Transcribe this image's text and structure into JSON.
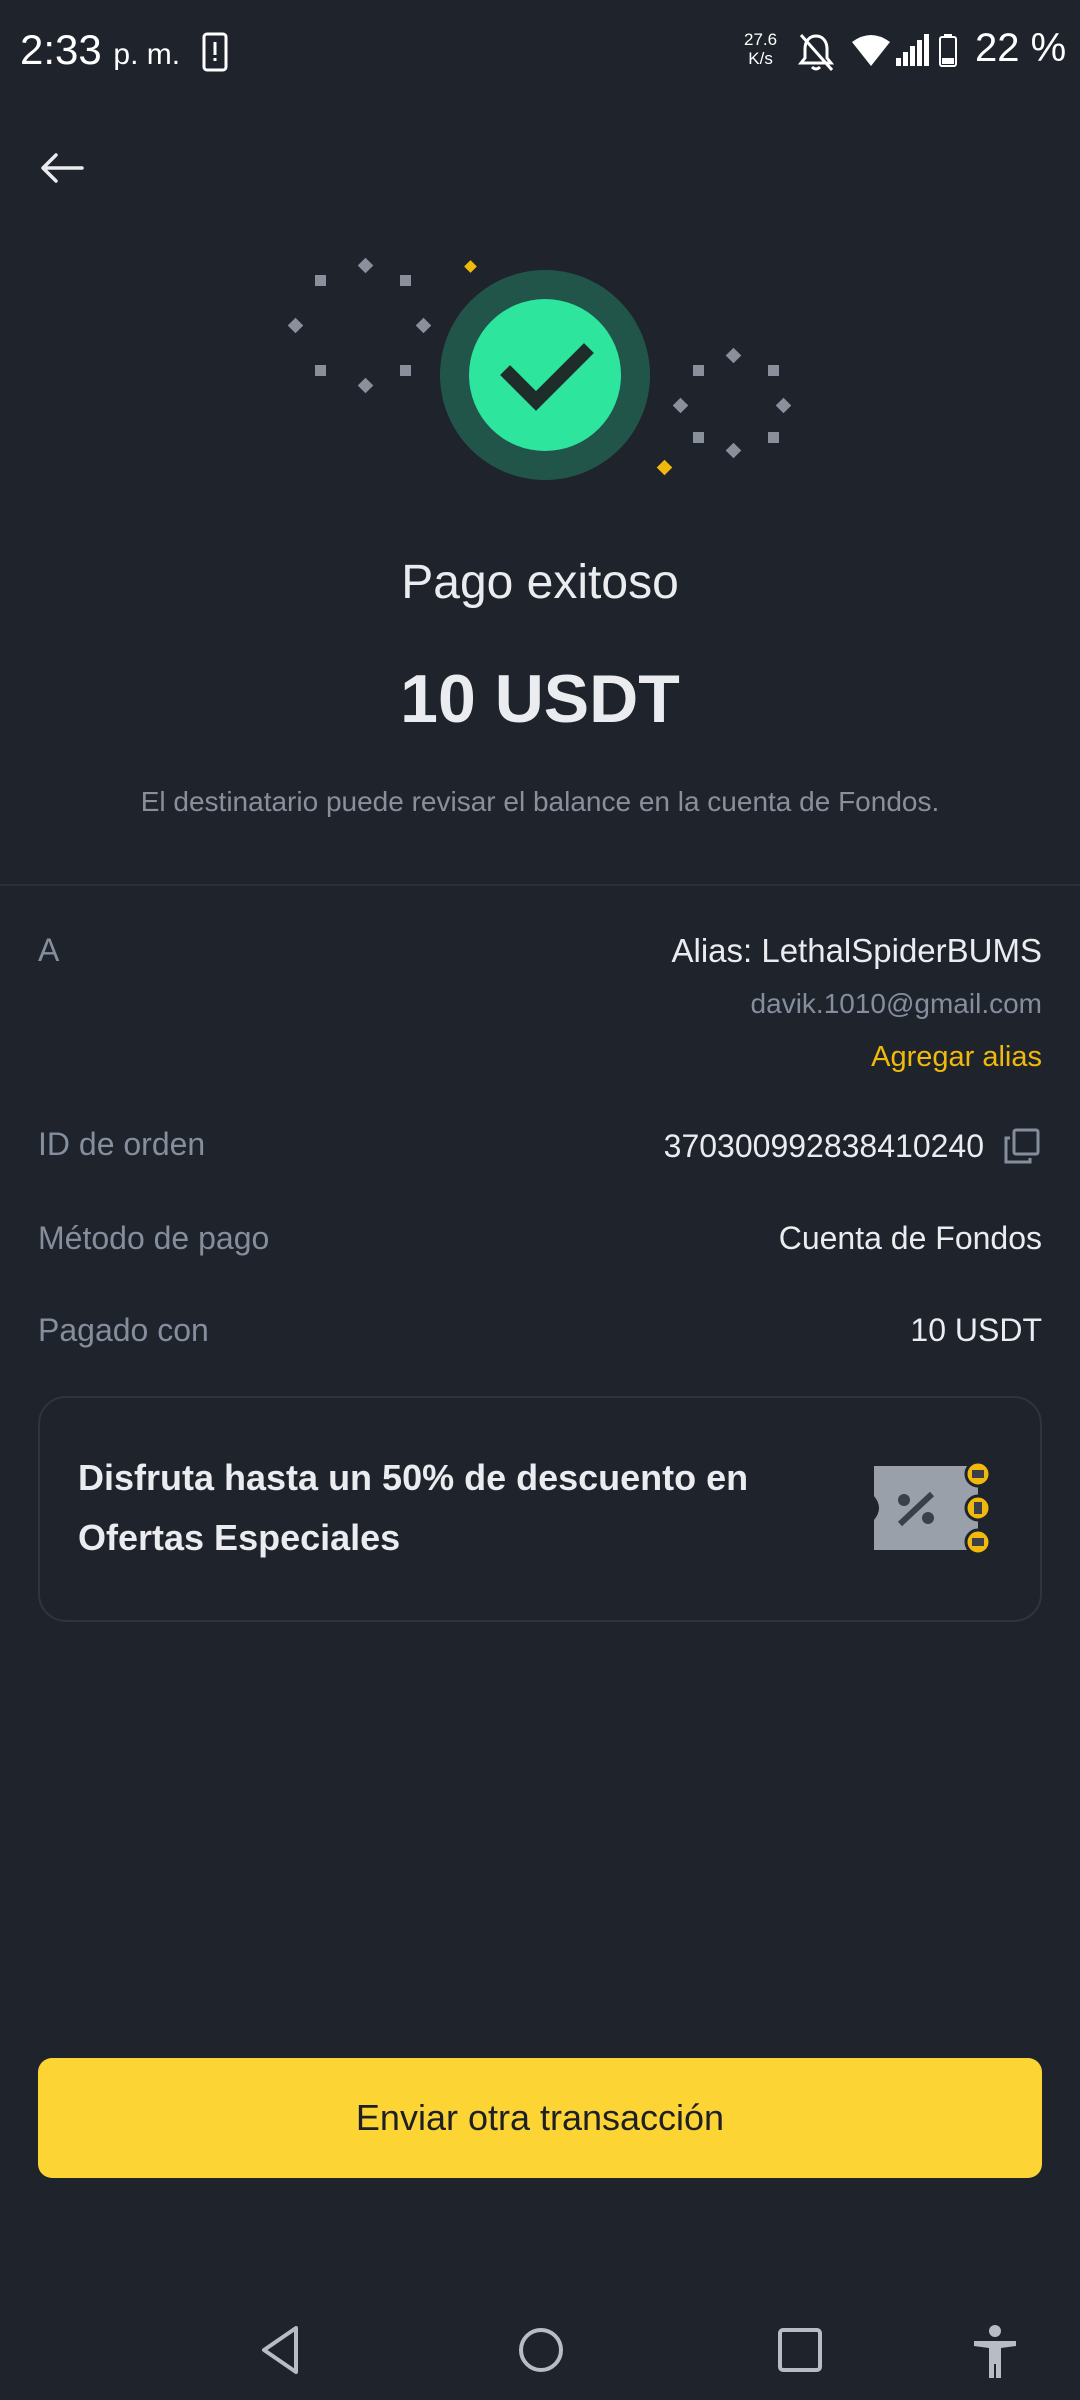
{
  "status_bar": {
    "time": "2:33",
    "ampm": "p. m.",
    "speed_value": "27.6",
    "speed_unit": "K/s",
    "battery": "22 %"
  },
  "icons": {
    "back": "arrow-left-icon",
    "success": "checkmark-icon",
    "copy": "copy-icon",
    "promo": "discount-ticket-icon"
  },
  "result": {
    "title": "Pago exitoso",
    "amount": "10 USDT",
    "subtitle": "El destinatario puede revisar el balance en la cuenta de Fondos."
  },
  "details": {
    "to_label": "A",
    "to_alias": "Alias: LethalSpiderBUMS",
    "to_email": "davik.1010@gmail.com",
    "add_alias": "Agregar alias",
    "order_label": "ID de orden",
    "order_value": "370300992838410240",
    "method_label": "Método de pago",
    "method_value": "Cuenta de Fondos",
    "paid_label": "Pagado con",
    "paid_value": "10 USDT"
  },
  "promo": {
    "text": "Disfruta hasta un 50% de descuento en Ofertas Especiales"
  },
  "actions": {
    "primary": "Enviar otra transacción"
  },
  "colors": {
    "background": "#1f232c",
    "accent_yellow": "#fcd535",
    "link_yellow": "#f0b90b",
    "success_green": "#2ee59d",
    "muted_text": "#848e9c"
  }
}
